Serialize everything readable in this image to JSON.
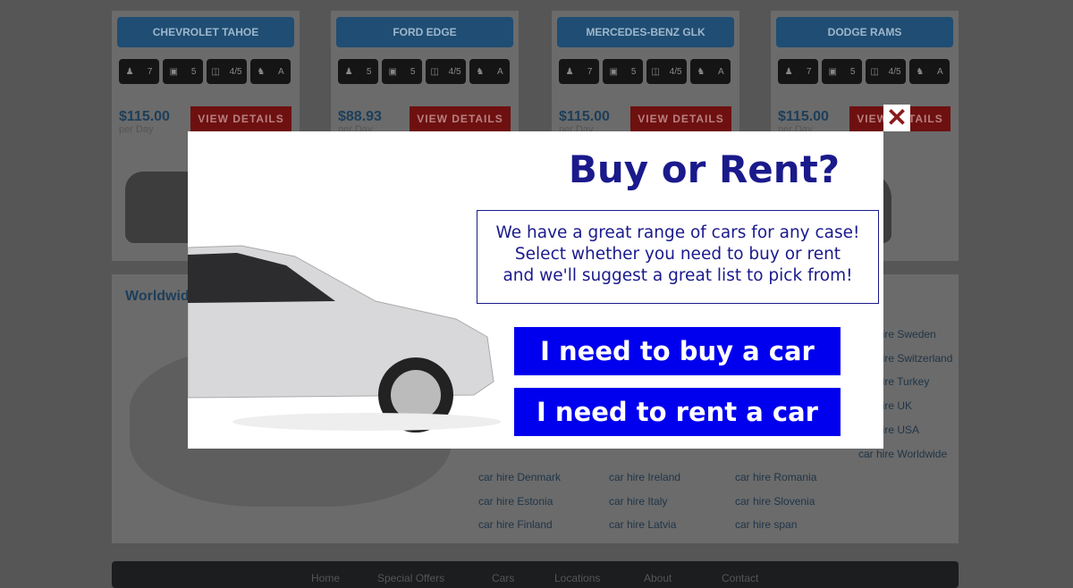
{
  "cars": [
    {
      "name": "CHEVROLET TAHOE",
      "seats": "7",
      "bags": "5",
      "doors": "4/5",
      "trans": "A",
      "price": "$115.00",
      "per": "per Day",
      "action": "VIEW DETAILS"
    },
    {
      "name": "FORD EDGE",
      "seats": "5",
      "bags": "5",
      "doors": "4/5",
      "trans": "A",
      "price": "$88.93",
      "per": "per Day",
      "action": "VIEW DETAILS"
    },
    {
      "name": "MERCEDES-BENZ GLK",
      "seats": "7",
      "bags": "5",
      "doors": "4/5",
      "trans": "A",
      "price": "$115.00",
      "per": "per Day",
      "action": "VIEW DETAILS"
    },
    {
      "name": "DODGE RAMS",
      "seats": "7",
      "bags": "5",
      "doors": "4/5",
      "trans": "A",
      "price": "$115.00",
      "per": "per Day",
      "action": "VIEW DETAILS"
    }
  ],
  "locations": {
    "heading": "Worldwide",
    "col1": [
      "car hire Denmark",
      "car hire Estonia",
      "car hire Finland"
    ],
    "col2": [
      "car hire Ireland",
      "car hire Italy",
      "car hire Latvia"
    ],
    "col3": [
      "car hire Romania",
      "car hire Slovenia",
      "car hire span"
    ],
    "col4": [
      "car hire Sweden",
      "car hire Switzerland",
      "car hire Turkey",
      "car hire UK",
      "car hire USA",
      "car hire Worldwide"
    ]
  },
  "footer": [
    "Home",
    "Special Offers",
    "Cars",
    "Locations",
    "About",
    "Contact"
  ],
  "modal": {
    "title": "Buy or Rent?",
    "text": [
      "We have a great range of cars for any case!",
      "Select whether you need to buy or rent",
      "and we'll suggest a great list to pick from!"
    ],
    "buy": "I need to buy a car",
    "rent": "I need to rent a car",
    "close": "✕"
  },
  "colors": {
    "button": "#0000ee",
    "title": "#1a1a8c"
  }
}
